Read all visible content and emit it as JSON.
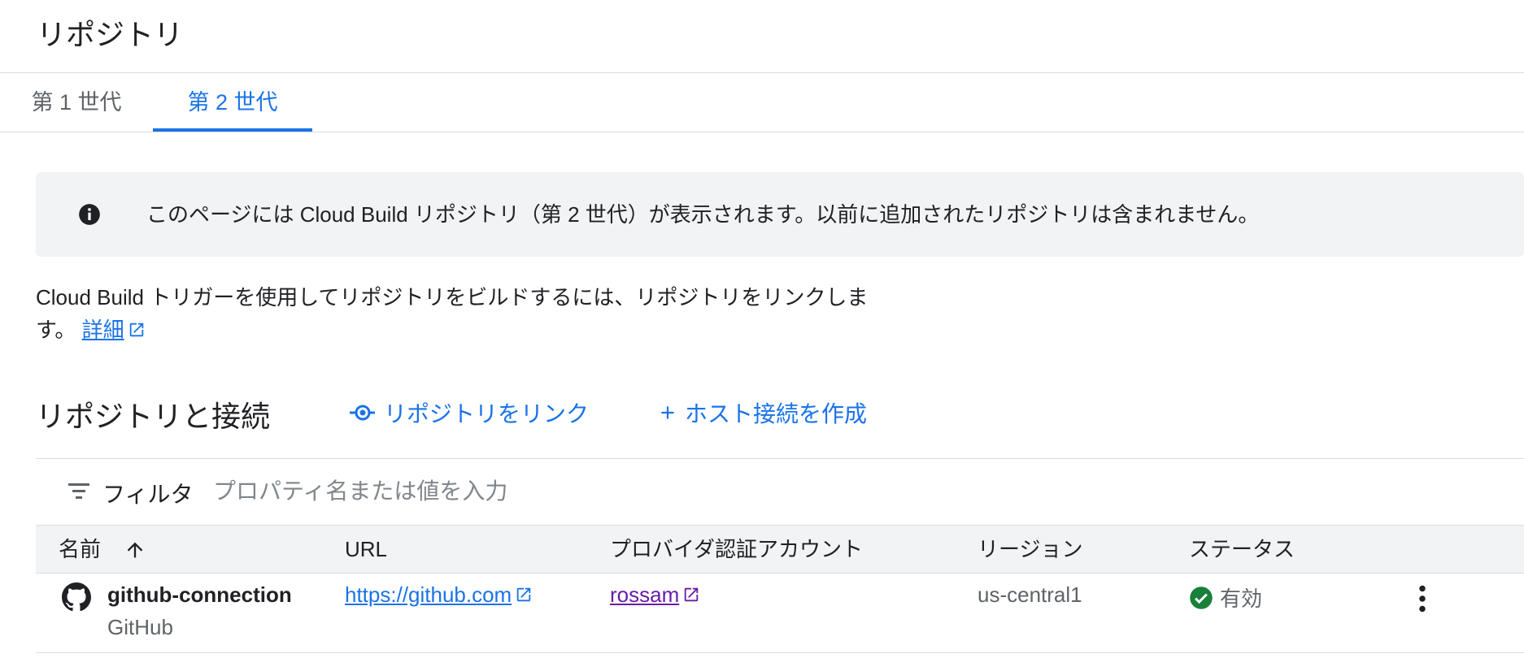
{
  "page": {
    "title": "リポジトリ"
  },
  "tabs": [
    {
      "label": "第 1 世代",
      "active": false
    },
    {
      "label": "第 2 世代",
      "active": true
    }
  ],
  "banner": {
    "icon": "info-icon",
    "text": "このページには Cloud Build リポジトリ（第 2 世代）が表示されます。以前に追加されたリポジトリは含まれません。"
  },
  "description": {
    "text": "Cloud Build トリガーを使用してリポジトリをビルドするには、リポジトリをリンクします。",
    "link_label": "詳細"
  },
  "section": {
    "title": "リポジトリと接続",
    "link_repo_label": "リポジトリをリンク",
    "create_host_label": "ホスト接続を作成"
  },
  "filter": {
    "label": "フィルタ",
    "placeholder": "プロパティ名または値を入力"
  },
  "table": {
    "columns": [
      "名前",
      "URL",
      "プロバイダ認証アカウント",
      "リージョン",
      "ステータス"
    ],
    "rows": [
      {
        "name": "github-connection",
        "provider": "GitHub",
        "url": "https://github.com",
        "account": "rossam",
        "region": "us-central1",
        "status": "有効"
      }
    ]
  },
  "colors": {
    "accent": "#1a73e8",
    "visited_link": "#681da8",
    "status_ok": "#188038",
    "banner_bg": "#f1f3f4",
    "divider": "#dadce0"
  }
}
